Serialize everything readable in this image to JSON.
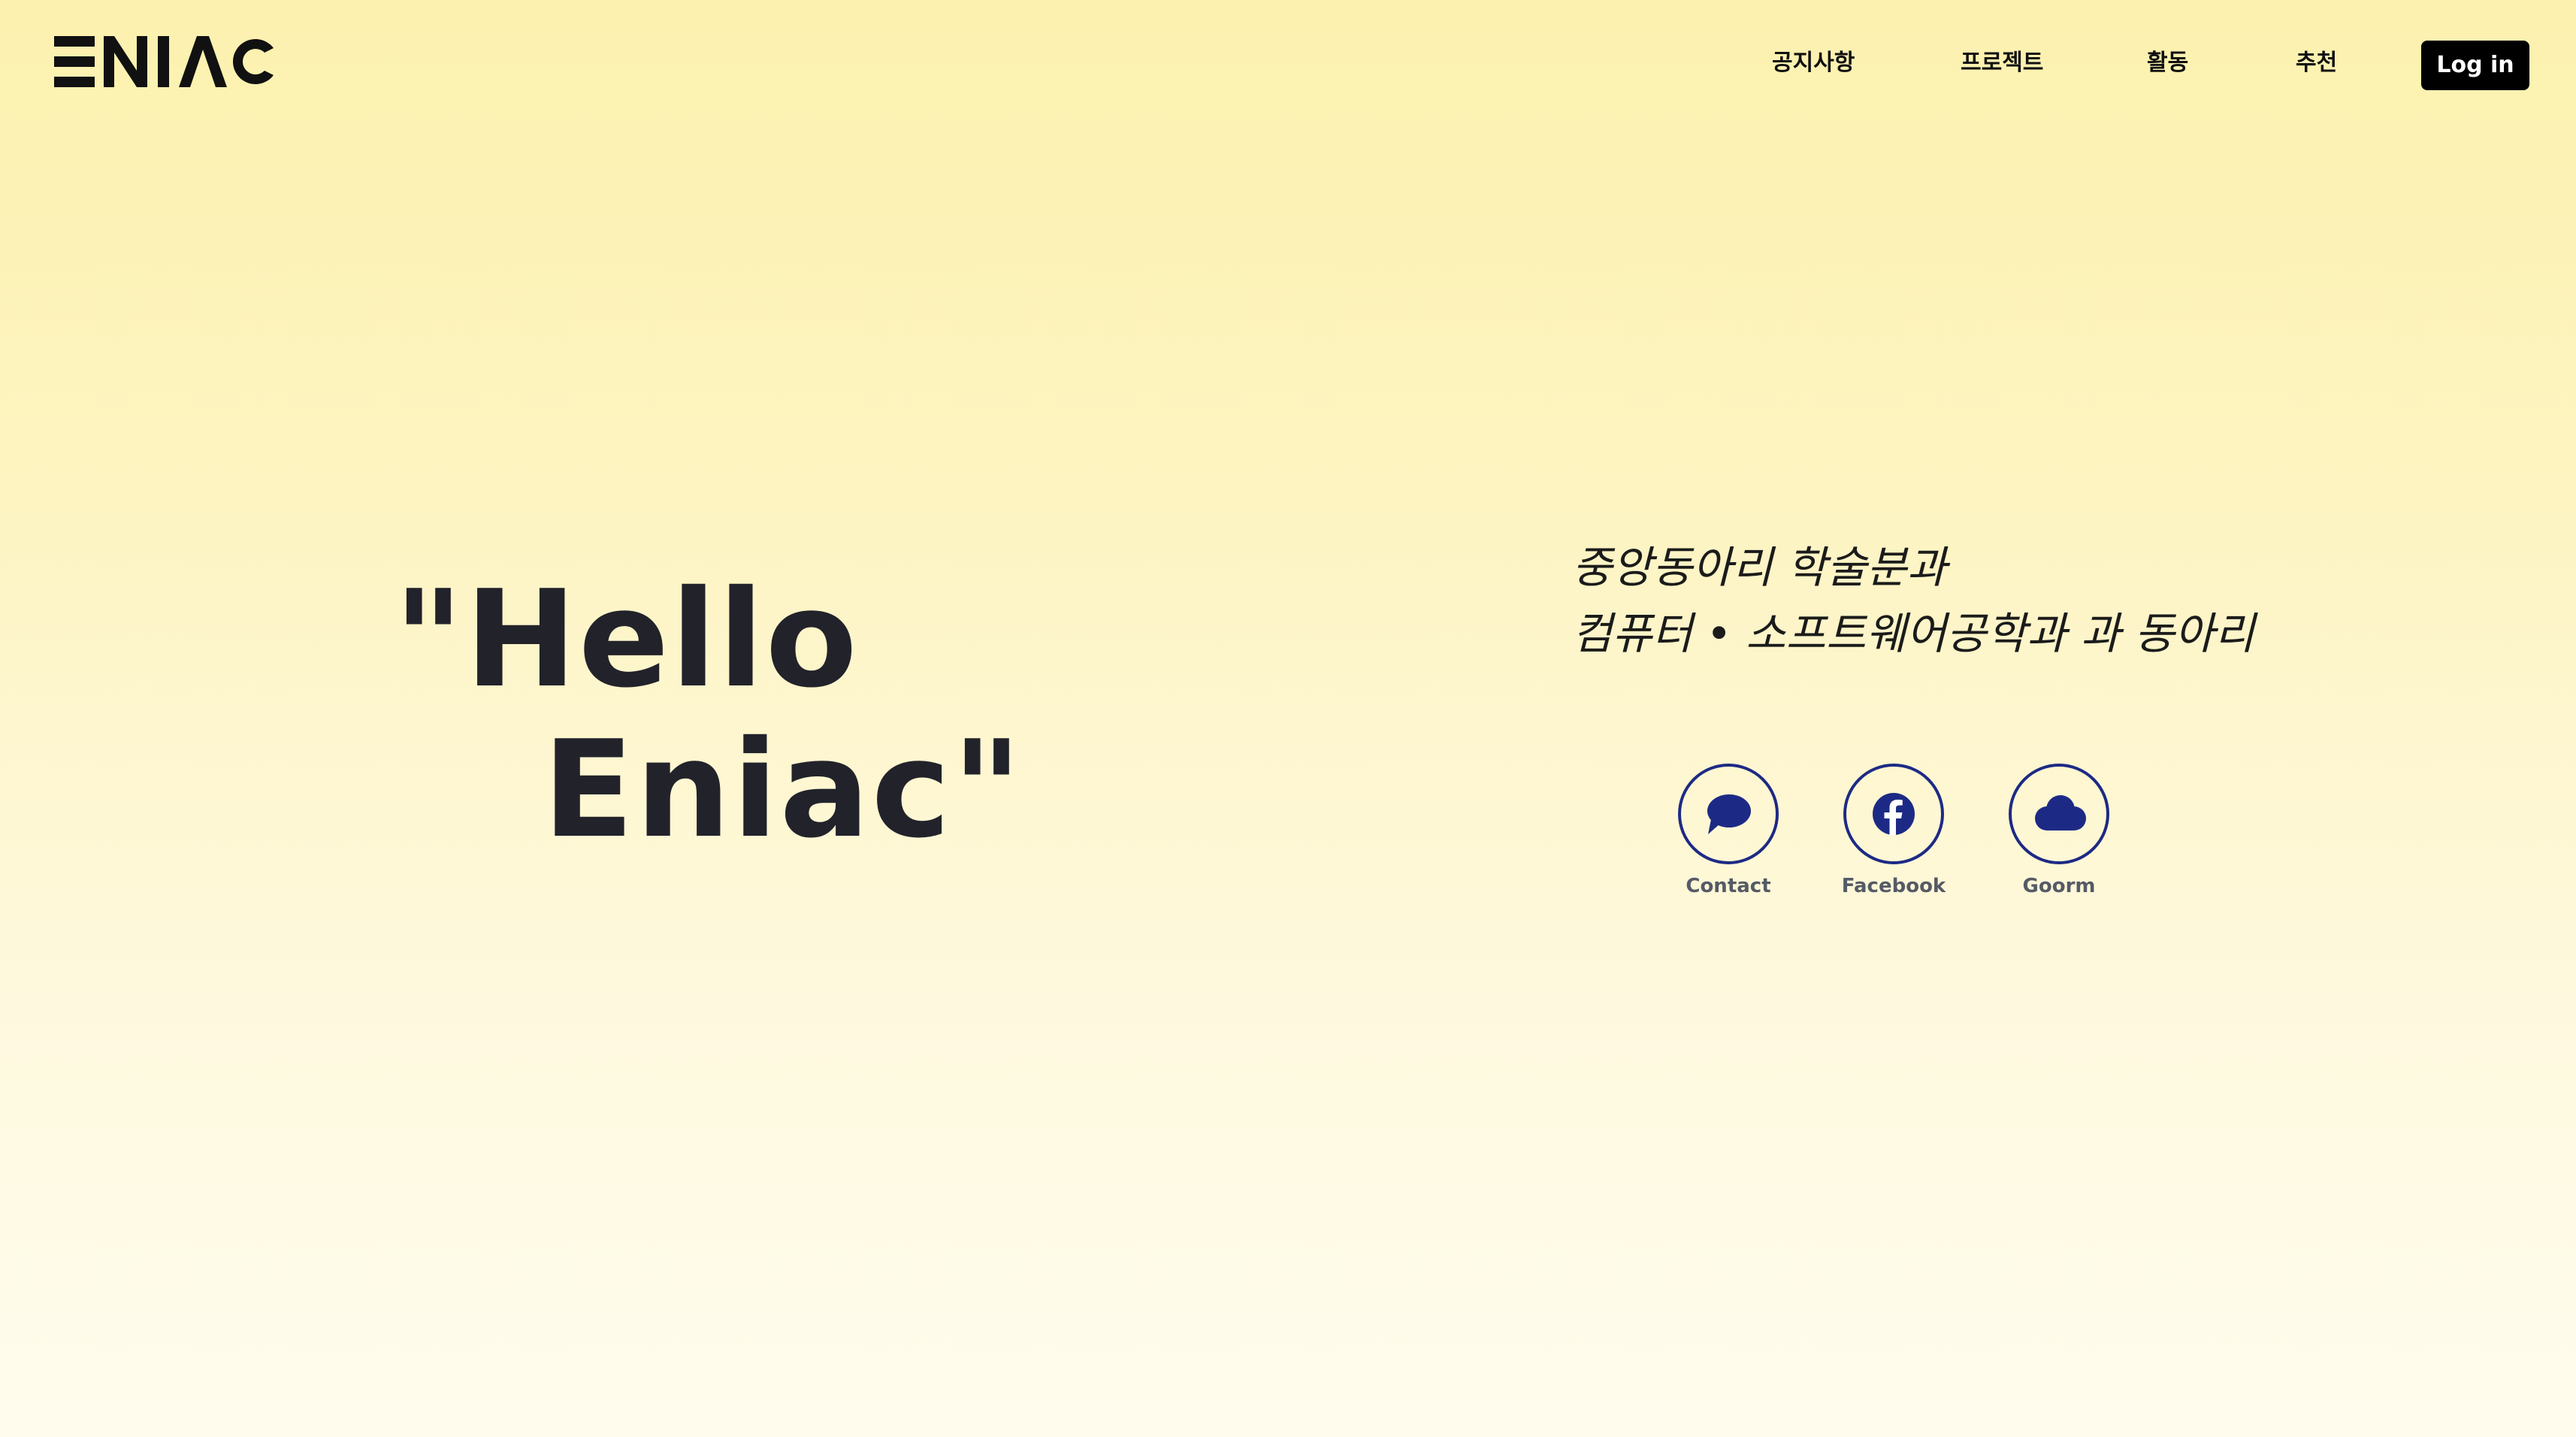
{
  "header": {
    "logo_text": "ENIAC",
    "nav": [
      {
        "label": "공지사항"
      },
      {
        "label": "프로젝트"
      },
      {
        "label": "활동"
      },
      {
        "label": "추천"
      }
    ],
    "login_label": "Log in"
  },
  "hero": {
    "line1": "\"Hello",
    "line2": "Eniac\""
  },
  "tagline": {
    "line1": "중앙동아리 학술분과",
    "line2": "컴퓨터 • 소프트웨어공학과 과 동아리"
  },
  "social": [
    {
      "label": "Contact",
      "icon": "chat-bubble-icon"
    },
    {
      "label": "Facebook",
      "icon": "facebook-icon"
    },
    {
      "label": "Goorm",
      "icon": "cloud-icon"
    }
  ],
  "colors": {
    "icon_accent": "#1d2a85",
    "text_dark": "#22222b",
    "button_bg": "#000000"
  }
}
